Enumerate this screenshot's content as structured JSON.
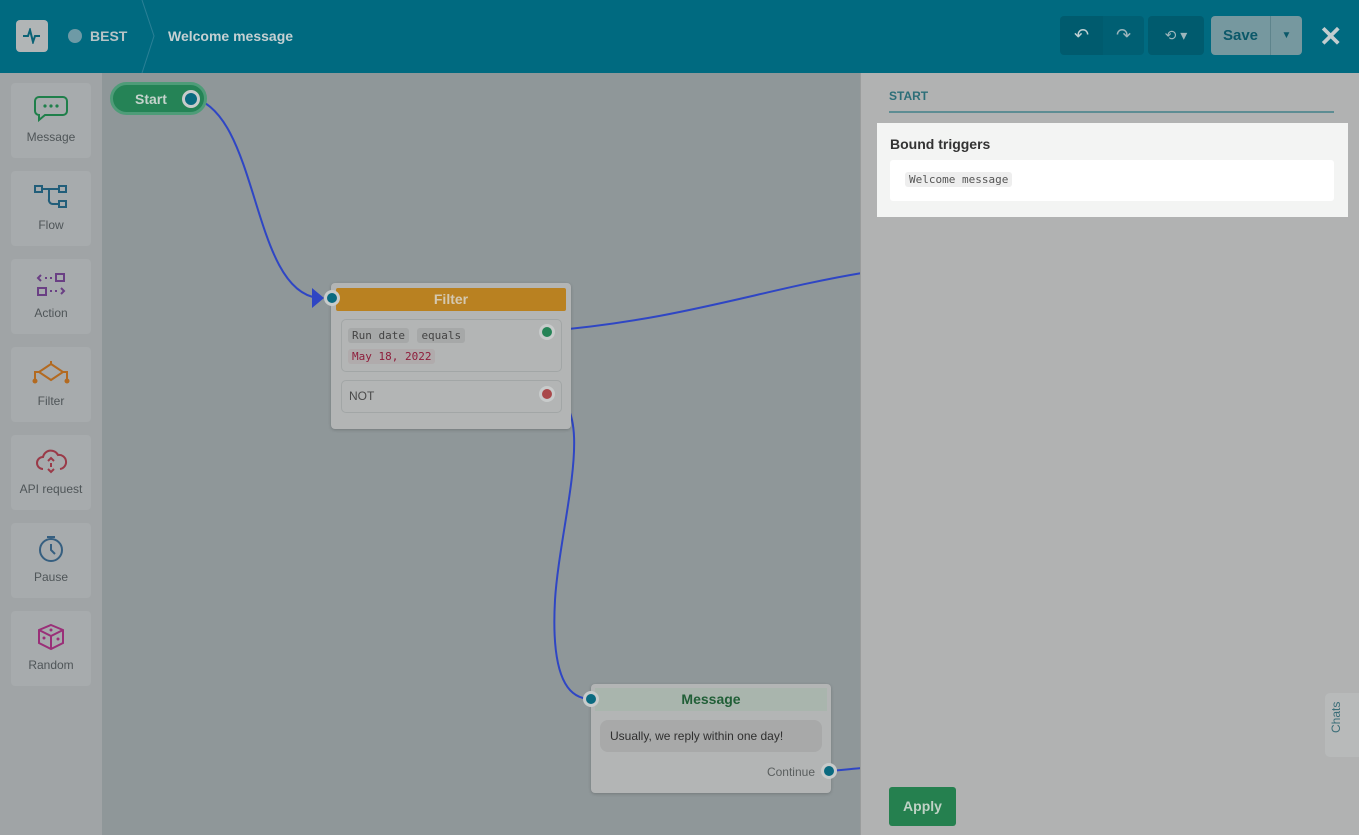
{
  "header": {
    "bot_name": "BEST",
    "flow_title": "Welcome message",
    "save_label": "Save"
  },
  "sidebar": {
    "items": [
      {
        "label": "Message",
        "icon": "message-icon",
        "color": "#1f7f4a"
      },
      {
        "label": "Flow",
        "icon": "flow-icon",
        "color": "#225e7a"
      },
      {
        "label": "Action",
        "icon": "action-icon",
        "color": "#6a3f84"
      },
      {
        "label": "Filter",
        "icon": "filter-icon",
        "color": "#b36a20"
      },
      {
        "label": "API request",
        "icon": "cloud-icon",
        "color": "#9a3a48"
      },
      {
        "label": "Pause",
        "icon": "timer-icon",
        "color": "#365f80"
      },
      {
        "label": "Random",
        "icon": "dice-icon",
        "color": "#9a2f78"
      }
    ]
  },
  "canvas": {
    "start_label": "Start",
    "filter": {
      "title": "Filter",
      "field": "Run date",
      "operator": "equals",
      "value": "May 18, 2022",
      "not_label": "NOT"
    },
    "message": {
      "title": "Message",
      "text": "Usually, we reply within one day!",
      "continue_label": "Continue"
    }
  },
  "panel": {
    "section": "START",
    "bound_title": "Bound triggers",
    "trigger": "Welcome message",
    "apply_label": "Apply",
    "chats_tab": "Chats"
  }
}
